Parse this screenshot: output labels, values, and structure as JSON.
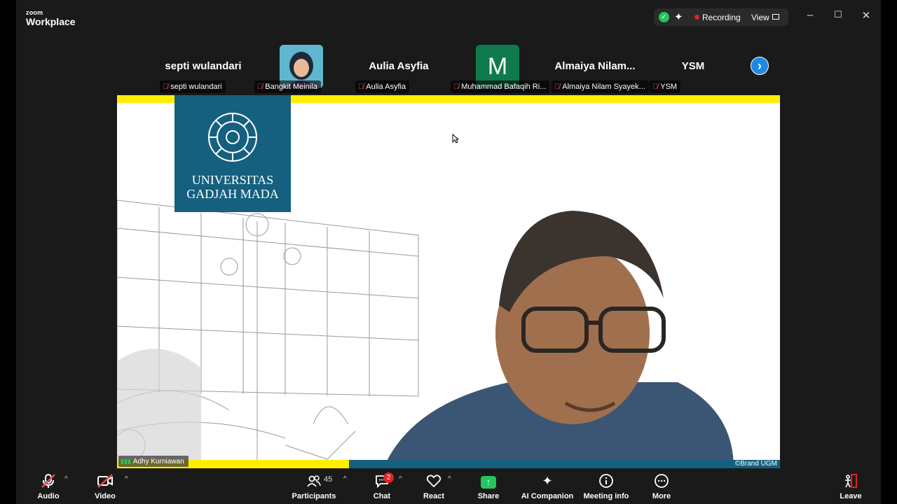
{
  "app": {
    "brand_small": "zoom",
    "brand_name": "Workplace"
  },
  "recording": {
    "label": "Recording",
    "view_label": "View",
    "security_icon": "shield-check-icon",
    "ai_icon": "sparkle-icon"
  },
  "window_controls": {
    "minimize": "–",
    "maximize": "☐",
    "close": "✕"
  },
  "participants_strip": {
    "tiles": [
      {
        "name": "septi wulandari",
        "label": "septi wulandari",
        "mic": "muted",
        "display": "name"
      },
      {
        "name": "",
        "label": "Bangkit Meinila",
        "mic": "muted",
        "display": "photo"
      },
      {
        "name": "Aulia Asyfia",
        "label": "Aulia Asyfia",
        "mic": "muted",
        "display": "name"
      },
      {
        "name": "M",
        "label": "Muhammad Bafaqih Ri...",
        "mic": "muted",
        "display": "letter",
        "avatar_color": "#0f7a4d"
      },
      {
        "name": "Almaiya  Nilam...",
        "label": "Almaiya Nilam Syayek...",
        "mic": "muted",
        "display": "name"
      },
      {
        "name": "YSM",
        "label": "YSM",
        "mic": "muted",
        "display": "name"
      }
    ],
    "next_icon": "chevron-right-icon"
  },
  "shared_screen": {
    "logo_line1": "UNIVERSITAS",
    "logo_line2": "GADJAH MADA",
    "speaker_name": "Adhy Kurniawan",
    "watermark": "©Brand UGM",
    "colors": {
      "yellow": "#ffee00",
      "blue": "#15607f"
    }
  },
  "toolbar": {
    "audio": "Audio",
    "video": "Video",
    "participants": "Participants",
    "participants_count": "45",
    "chat": "Chat",
    "chat_badge": "2",
    "react": "React",
    "share": "Share",
    "ai_companion": "AI Companion",
    "meeting_info": "Meeting info",
    "more": "More",
    "leave": "Leave"
  }
}
